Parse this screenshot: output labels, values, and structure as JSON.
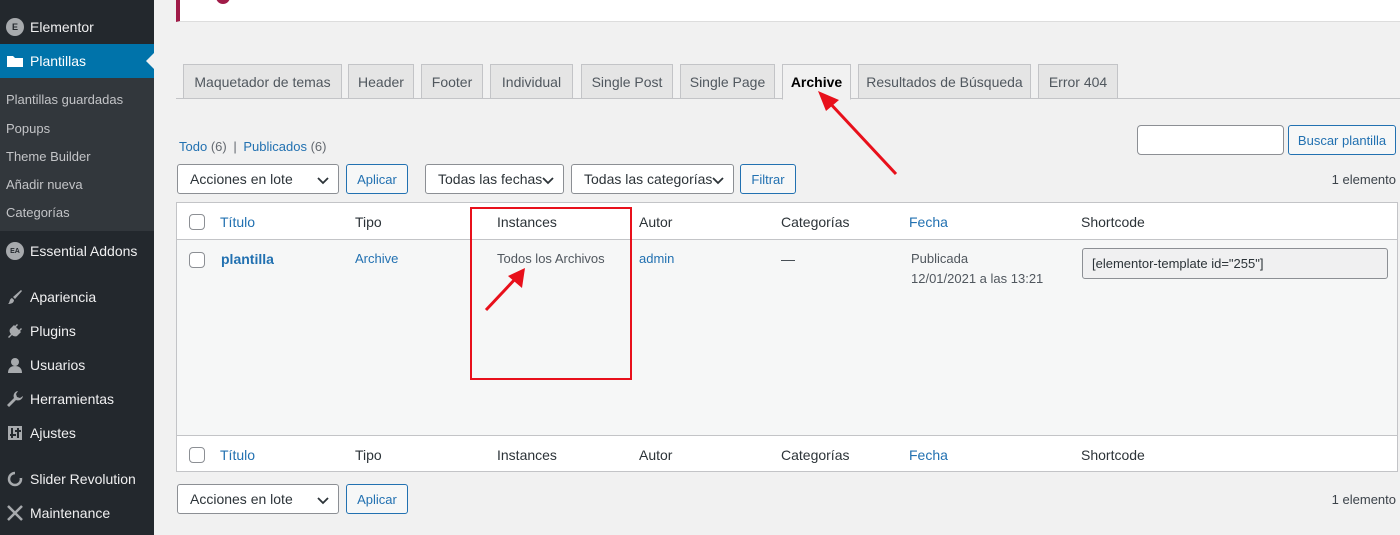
{
  "sidebar": {
    "elementor": "Elementor",
    "plantillas": "Plantillas",
    "submenu": [
      "Plantillas guardadas",
      "Popups",
      "Theme Builder",
      "Añadir nueva",
      "Categorías"
    ],
    "essential": "Essential Addons",
    "items": [
      "Apariencia",
      "Plugins",
      "Usuarios",
      "Herramientas",
      "Ajustes"
    ],
    "slider": "Slider Revolution",
    "maintenance": "Maintenance",
    "icons": {
      "elementor": "E",
      "essential": "EA"
    }
  },
  "tabs": [
    "Maquetador de temas",
    "Header",
    "Footer",
    "Individual",
    "Single Post",
    "Single Page",
    "Archive",
    "Resultados de Búsqueda",
    "Error 404"
  ],
  "filters": {
    "todo": "Todo",
    "todo_count": "(6)",
    "separator": "|",
    "publicados": "Publicados",
    "publicados_count": "(6)"
  },
  "search": {
    "placeholder": "",
    "button": "Buscar plantilla"
  },
  "bulk": {
    "action": "Acciones en lote",
    "apply": "Aplicar",
    "dates": "Todas las fechas",
    "categories": "Todas las categorías",
    "filter": "Filtrar",
    "count": "1 elemento"
  },
  "table": {
    "columns": [
      "Título",
      "Tipo",
      "Instances",
      "Autor",
      "Categorías",
      "Fecha",
      "Shortcode"
    ],
    "row": {
      "title": "plantilla",
      "type": "Archive",
      "instances": "Todos los Archivos",
      "author": "admin",
      "categories": "—",
      "status": "Publicada",
      "date": "12/01/2021 a las 13:21",
      "shortcode": "[elementor-template id=\"255\"]"
    }
  },
  "colors": {
    "accent": "#0073aa",
    "annotation": "#e8101b",
    "sidebar": "#23282d"
  }
}
